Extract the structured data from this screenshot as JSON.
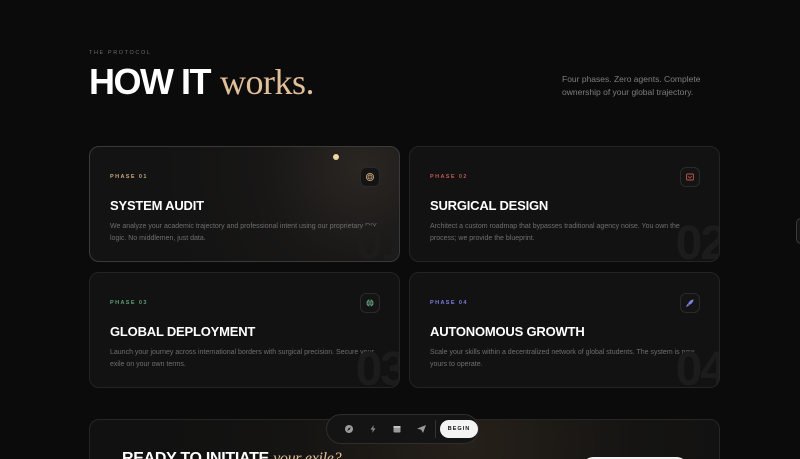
{
  "section": {
    "eyebrow": "THE PROTOCOL",
    "headline_bold": "HOW IT",
    "headline_serif": "works.",
    "tagline": "Four phases. Zero agents. Complete ownership of your global trajectory."
  },
  "cards": [
    {
      "phase": "PHASE 01",
      "title": "SYSTEM AUDIT",
      "description": "We analyze your academic trajectory and professional intent using our proprietary DIY logic. No middlemen, just data.",
      "number": "01",
      "icon": "fingerprint-icon",
      "accent": "#c9a57a"
    },
    {
      "phase": "PHASE 02",
      "title": "SURGICAL DESIGN",
      "description": "Architect a custom roadmap that bypasses traditional agency noise. You own the process; we provide the blueprint.",
      "number": "02",
      "icon": "blueprint-icon",
      "accent": "#c0574f"
    },
    {
      "phase": "PHASE 03",
      "title": "GLOBAL DEPLOYMENT",
      "description": "Launch your journey across international borders with surgical precision. Secure your exile on your own terms.",
      "number": "03",
      "icon": "globe-icon",
      "accent": "#5f9e78"
    },
    {
      "phase": "PHASE 04",
      "title": "AUTONOMOUS GROWTH",
      "description": "Scale your skills within a decentralized network of global students. The system is now yours to operate.",
      "number": "04",
      "icon": "rocket-icon",
      "accent": "#7b7fe0"
    }
  ],
  "cta": {
    "title_bold": "READY TO INITIATE",
    "title_serif": "your exile?"
  },
  "dock": {
    "icons": [
      "compass-icon",
      "bolt-icon",
      "calendar-icon",
      "send-icon"
    ],
    "button_label": "BEGIN"
  }
}
